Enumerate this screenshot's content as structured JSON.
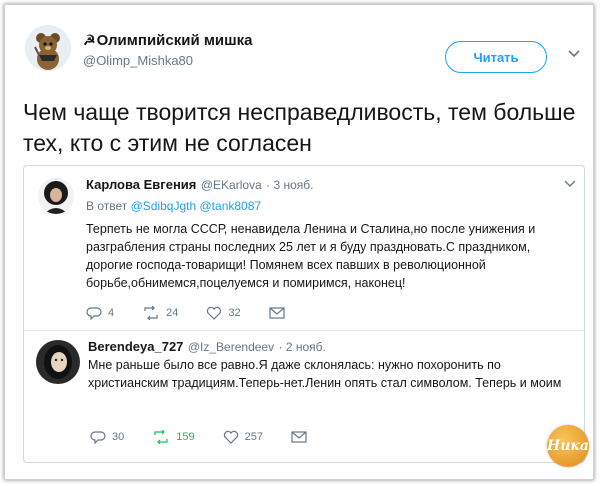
{
  "tweet": {
    "author_name": "Олимпийский мишка",
    "author_prefix": "☭",
    "author_handle": "@Olimp_Mishka80",
    "follow_label": "Читать",
    "text": "Чем чаще творится несправедливость, тем больше тех, кто с этим не согласен"
  },
  "quoted": [
    {
      "name": "Карлова Евгения",
      "handle": "@EKarlova",
      "date": "· 3 нояб.",
      "reply_prefix": "В ответ",
      "reply_to": "@SdibqJgth @tank8087",
      "text": "Терпеть не могла СССР, ненавидела Ленина и Сталина,но после унижения и разграбления страны последних 25 лет и я буду праздновать.С праздником, дорогие господа-товарищи! Помянем всех павших в революционной борьбе,обнимемся,поцелуемся и помиримся, наконец!",
      "replies": "4",
      "retweets": "24",
      "likes": "32"
    },
    {
      "name": "Berendeya_727",
      "handle": "@Iz_Berendeev",
      "date": "· 2 нояб.",
      "text": "Мне раньше было все равно.Я даже склонялась: нужно похоронить по христианским традициям.Теперь-нет.Ленин опять стал символом. Теперь и моим",
      "replies": "30",
      "retweets": "159",
      "likes": "257"
    }
  ],
  "watermark": "Ника",
  "colors": {
    "accent": "#1da1f2",
    "retweet": "#17bf63",
    "muted": "#657786",
    "text": "#14171a"
  },
  "icons": [
    "bear-avatar-icon",
    "chevron-down-icon",
    "reply-icon",
    "retweet-icon",
    "like-icon",
    "message-icon"
  ]
}
